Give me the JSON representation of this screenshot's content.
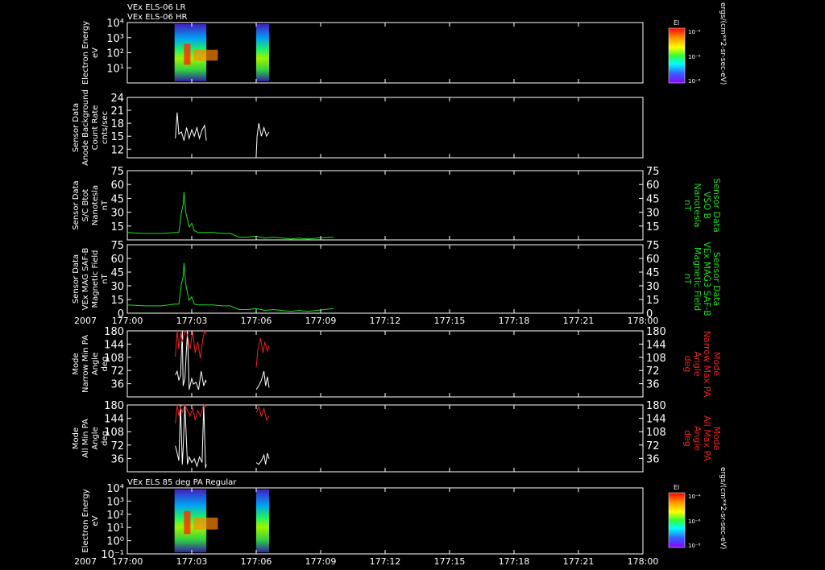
{
  "header": {
    "line1": "VEx ELS-06 LR",
    "line2": "VEx ELS-06 HR",
    "bottom_title": "VEx ELS 85 deg PA Regular"
  },
  "colors": {
    "white": "#ffffff",
    "green": "#22dd22",
    "red": "#ee2222",
    "background": "#000000"
  },
  "time_axis": {
    "year": "2007",
    "ticks": [
      "177:00",
      "177:03",
      "177:06",
      "177:09",
      "177:12",
      "177:15",
      "177:18",
      "177:21",
      "178:00"
    ],
    "range_minutes": [
      0,
      60
    ]
  },
  "colorbars": [
    {
      "title": "El",
      "ticks": [
        "10⁻⁴",
        "10⁻⁶",
        "10⁻⁸"
      ],
      "unit": "ergs/(cm**2-sr-sec-eV)"
    },
    {
      "title": "El",
      "ticks": [
        "10⁻⁴",
        "10⁻⁶",
        "10⁻⁸"
      ],
      "unit": "ergs/(cm**2-sr-sec-eV)"
    }
  ],
  "chart_data": [
    {
      "type": "heatmap",
      "ylabel": [
        "Electron Energy",
        "eV"
      ],
      "yscale": "log",
      "ylim": [
        1,
        10000
      ],
      "yticks": [
        "10⁴",
        "10³",
        "10²",
        "10¹"
      ],
      "data_intervals_minutes": [
        [
          5.5,
          9.2
        ],
        [
          15.0,
          16.5
        ]
      ],
      "energy_peak_minutes": 6.6
    },
    {
      "type": "line",
      "ylabel": [
        "Sensor Data",
        "Anode Background",
        "Count Rate",
        "cnts/sec"
      ],
      "ylim": [
        10,
        24
      ],
      "yticks": [
        "24",
        "21",
        "18",
        "15",
        "12"
      ],
      "series": [
        {
          "color": "#ffffff",
          "segments": [
            {
              "x": [
                5.6,
                5.8,
                6.0,
                6.3,
                6.6,
                6.9,
                7.2,
                7.5,
                7.8,
                8.1,
                8.4,
                8.7,
                9.0,
                9.2
              ],
              "y": [
                14.5,
                20.5,
                15.5,
                16.0,
                14.0,
                17.0,
                14.5,
                16.5,
                15.0,
                17.0,
                14.5,
                16.5,
                17.5,
                14.0
              ]
            },
            {
              "x": [
                15.0,
                15.1,
                15.3,
                15.6,
                15.9,
                16.2,
                16.5
              ],
              "y": [
                10.5,
                15.0,
                18.0,
                15.0,
                17.0,
                15.0,
                16.0
              ]
            }
          ]
        }
      ]
    },
    {
      "type": "line",
      "ylabel": [
        "Sensor Data",
        "S/C Btot",
        "Nanotesla",
        "nT"
      ],
      "ylabel_right": [
        "Sensor Data",
        "VSO B",
        "Nanotesla",
        "nT"
      ],
      "ylim": [
        0,
        75
      ],
      "yticks": [
        "75",
        "60",
        "45",
        "30",
        "15"
      ],
      "series": [
        {
          "color": "#22dd22",
          "x": [
            0,
            2,
            4,
            5.5,
            6.0,
            6.3,
            6.5,
            6.6,
            6.8,
            7.0,
            7.2,
            7.5,
            7.8,
            8.2,
            9.0,
            10,
            11,
            12,
            13,
            14,
            15,
            16,
            17,
            18,
            19,
            20,
            21,
            22,
            24
          ],
          "y": [
            8,
            7,
            7,
            8,
            8,
            30,
            38,
            52,
            30,
            22,
            14,
            18,
            10,
            8,
            8,
            8,
            7,
            7,
            3,
            3,
            4,
            2,
            3,
            2,
            1,
            2,
            1,
            2,
            3
          ]
        }
      ]
    },
    {
      "type": "line",
      "ylabel": [
        "Sensor Data",
        "VEx MAG SAF-B",
        "Magnetic Field",
        "nT"
      ],
      "ylabel_right": [
        "Sensor Data",
        "VEx MAG3 SAF-B",
        "Magnetic Field",
        "nT"
      ],
      "ylim": [
        0,
        75
      ],
      "yticks": [
        "75",
        "60",
        "45",
        "30",
        "15",
        "0"
      ],
      "series": [
        {
          "color": "#22dd22",
          "x": [
            0,
            2,
            4,
            5.5,
            6.0,
            6.3,
            6.5,
            6.6,
            6.8,
            7.0,
            7.2,
            7.5,
            7.8,
            8.2,
            9.0,
            10,
            11,
            12,
            13,
            14,
            15,
            16,
            17,
            18,
            19,
            20,
            21,
            22,
            24
          ],
          "y": [
            9,
            8,
            8,
            10,
            10,
            32,
            40,
            55,
            32,
            22,
            14,
            18,
            10,
            9,
            9,
            9,
            8,
            8,
            4,
            4,
            5,
            3,
            4,
            3,
            2,
            3,
            2,
            3,
            5
          ]
        }
      ]
    },
    {
      "type": "line",
      "ylabel": [
        "Mode",
        "Narrow Min PA",
        "Angle",
        "deg"
      ],
      "ylabel_right": [
        "Mode",
        "Narrow Max PA",
        "Angle",
        "deg"
      ],
      "ylim": [
        0,
        180
      ],
      "yticks": [
        "180",
        "144",
        "108",
        "72",
        "36"
      ],
      "series": [
        {
          "name": "Min PA",
          "color": "#ffffff",
          "segments": [
            {
              "x": [
                5.6,
                5.8,
                6.0,
                6.2,
                6.4,
                6.5,
                6.7,
                7.0,
                7.2,
                7.5,
                7.7,
                8.0,
                8.3,
                8.6,
                8.9,
                9.1,
                9.2
              ],
              "y": [
                60,
                70,
                45,
                60,
                180,
                30,
                50,
                180,
                20,
                50,
                35,
                40,
                20,
                70,
                30,
                45,
                40
              ]
            },
            {
              "x": [
                15.0,
                15.3,
                15.6,
                15.9,
                16.1,
                16.3,
                16.5
              ],
              "y": [
                20,
                30,
                45,
                70,
                30,
                55,
                25
              ]
            }
          ]
        },
        {
          "name": "Max PA",
          "color": "#ee2222",
          "segments": [
            {
              "x": [
                5.6,
                5.8,
                6.0,
                6.2,
                6.4,
                6.7,
                7.0,
                7.3,
                7.6,
                7.9,
                8.2,
                8.5,
                8.8,
                9.0,
                9.2
              ],
              "y": [
                110,
                180,
                130,
                175,
                150,
                180,
                170,
                130,
                180,
                120,
                150,
                105,
                160,
                180,
                170
              ]
            },
            {
              "x": [
                15.0,
                15.2,
                15.5,
                15.8,
                16.0,
                16.3,
                16.5
              ],
              "y": [
                80,
                130,
                160,
                120,
                150,
                125,
                140
              ]
            }
          ]
        }
      ]
    },
    {
      "type": "line",
      "ylabel": [
        "Mode",
        "All Min PA",
        "Angle",
        "deg"
      ],
      "ylabel_right": [
        "Mode",
        "All Max PA",
        "Angle",
        "deg"
      ],
      "ylim": [
        0,
        180
      ],
      "yticks": [
        "180",
        "144",
        "108",
        "72",
        "36"
      ],
      "series": [
        {
          "name": "Min PA",
          "color": "#ffffff",
          "segments": [
            {
              "x": [
                5.6,
                5.8,
                6.0,
                6.2,
                6.4,
                6.5,
                6.7,
                7.0,
                7.2,
                7.5,
                7.8,
                8.1,
                8.4,
                8.7,
                8.9,
                9.1,
                9.2
              ],
              "y": [
                70,
                50,
                30,
                180,
                20,
                60,
                180,
                20,
                40,
                25,
                35,
                15,
                40,
                25,
                180,
                10,
                20
              ]
            },
            {
              "x": [
                15.0,
                15.3,
                15.6,
                15.9,
                16.1,
                16.3,
                16.5
              ],
              "y": [
                25,
                20,
                30,
                45,
                20,
                50,
                35
              ]
            }
          ]
        },
        {
          "name": "Max PA",
          "color": "#ee2222",
          "segments": [
            {
              "x": [
                5.6,
                5.8,
                6.0,
                6.2,
                6.4,
                6.7,
                7.0,
                7.3,
                7.6,
                7.9,
                8.2,
                8.5,
                8.8,
                9.0,
                9.2
              ],
              "y": [
                130,
                180,
                150,
                175,
                160,
                180,
                165,
                150,
                170,
                140,
                165,
                150,
                175,
                180,
                175
              ]
            },
            {
              "x": [
                15.0,
                15.3,
                15.6,
                15.9,
                16.2,
                16.5
              ],
              "y": [
                160,
                175,
                150,
                170,
                140,
                150
              ]
            }
          ]
        }
      ]
    },
    {
      "type": "heatmap",
      "ylabel": [
        "Electron Energy",
        "eV"
      ],
      "yscale": "log",
      "ylim": [
        0.1,
        10000
      ],
      "yticks": [
        "10⁴",
        "10³",
        "10²",
        "10¹",
        "10⁰",
        "10⁻¹"
      ],
      "data_intervals_minutes": [
        [
          5.5,
          9.2
        ],
        [
          15.0,
          16.5
        ]
      ],
      "energy_peak_minutes": 6.6
    }
  ]
}
